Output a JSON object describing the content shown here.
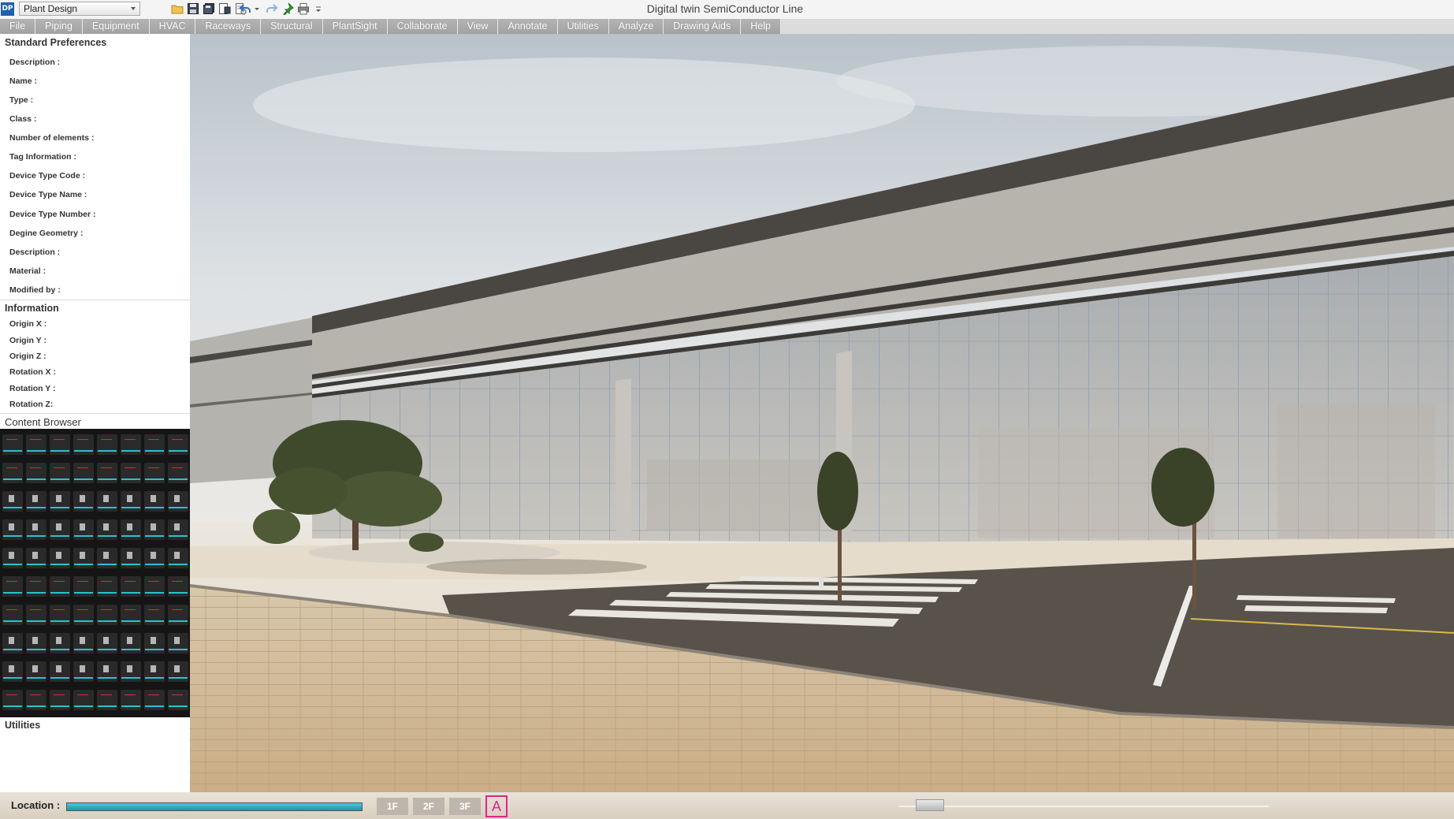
{
  "app": {
    "logo_text": "DP",
    "window_title": "Digital twin SemiConductor Line"
  },
  "toolbar": {
    "workspace": "Plant Design",
    "icons": [
      "open-folder-icon",
      "save-icon",
      "save-all-icon",
      "save-as-icon",
      "properties-icon",
      "undo-icon",
      "dropdown-icon",
      "redo-icon",
      "pin-icon",
      "print-icon",
      "more-icon"
    ]
  },
  "menu": [
    "File",
    "Piping",
    "Equipment",
    "HVAC",
    "Raceways",
    "Structural",
    "PlantSight",
    "Collaborate",
    "View",
    "Annotate",
    "Utilities",
    "Analyze",
    "Drawing Aids",
    "Help"
  ],
  "standard_preferences": {
    "title": "Standard Preferences",
    "fields": [
      "Description :",
      "Name :",
      "Type :",
      "Class :",
      "Number of elements :",
      "Tag Information :",
      "Device Type Code :",
      "Device Type Name :",
      "Device Type Number :",
      "Degine Geometry :",
      "Description :",
      "Material :",
      "Modified by :"
    ]
  },
  "information": {
    "title": "Information",
    "fields": [
      "Origin X :",
      "Origin Y :",
      "Origin Z :",
      "Rotation X :",
      "Rotation Y :",
      "Rotation Z:"
    ]
  },
  "content_browser": {
    "title": "Content Browser",
    "rows": 10,
    "cols": 8
  },
  "utilities": {
    "title": "Utilities"
  },
  "status": {
    "location_label": "Location :",
    "location_progress": 1.0,
    "floors": [
      "1F",
      "2F",
      "3F"
    ],
    "annotate_label": "A",
    "view_slider": 0.05
  },
  "colors": {
    "accent": "#29c2cf",
    "menu_bg": "#a8a8a8",
    "annotate": "#e0248c"
  }
}
